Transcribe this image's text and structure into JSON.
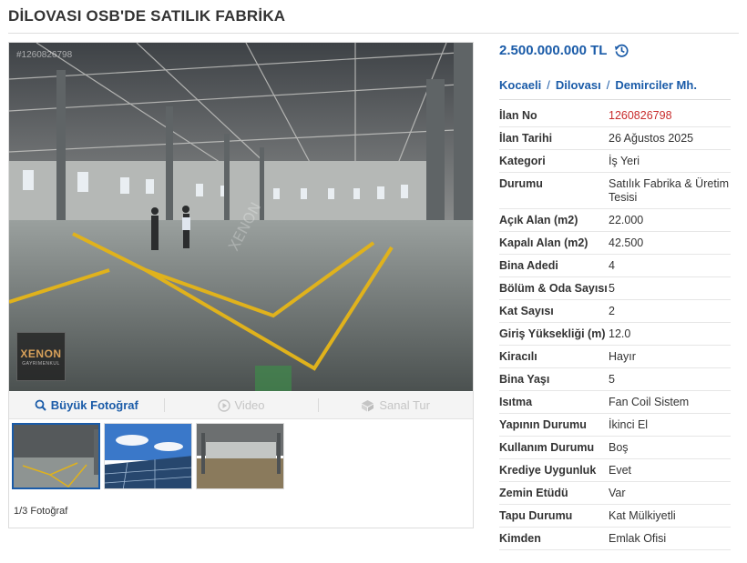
{
  "page": {
    "title": "DİLOVASI OSB'DE SATILIK FABRİKA"
  },
  "photo": {
    "listing_id_overlay": "#1260826798",
    "watermark_name": "XENON",
    "watermark_sub": "GAYRIMENKUL",
    "tabs": [
      {
        "label": "Büyük Fotoğraf",
        "icon": "magnifier-icon",
        "state": "active"
      },
      {
        "label": "Video",
        "icon": "play-icon",
        "state": "disabled"
      },
      {
        "label": "Sanal Tur",
        "icon": "cube-icon",
        "state": "disabled"
      }
    ],
    "thumbnails": [
      "warehouse-interior",
      "solar-roof",
      "warehouse-hall"
    ],
    "count_label": "1/3 Fotoğraf"
  },
  "price": {
    "value": "2.500.000.000 TL",
    "history_icon": "price-history-icon"
  },
  "location": {
    "city": "Kocaeli",
    "district": "Dilovası",
    "neighborhood": "Demirciler Mh.",
    "separator": "/"
  },
  "details": [
    {
      "label": "İlan No",
      "value": "1260826798",
      "highlight": true
    },
    {
      "label": "İlan Tarihi",
      "value": "26 Ağustos 2025"
    },
    {
      "label": "Kategori",
      "value": "İş Yeri"
    },
    {
      "label": "Durumu",
      "value": "Satılık Fabrika & Üretim Tesisi"
    },
    {
      "label": "Açık Alan (m2)",
      "value": "22.000"
    },
    {
      "label": "Kapalı Alan (m2)",
      "value": "42.500"
    },
    {
      "label": "Bina Adedi",
      "value": "4"
    },
    {
      "label": "Bölüm & Oda Sayısı",
      "value": "5"
    },
    {
      "label": "Kat Sayısı",
      "value": "2"
    },
    {
      "label": "Giriş Yüksekliği (m)",
      "value": "12.0"
    },
    {
      "label": "Kiracılı",
      "value": "Hayır"
    },
    {
      "label": "Bina Yaşı",
      "value": "5"
    },
    {
      "label": "Isıtma",
      "value": "Fan Coil Sistem"
    },
    {
      "label": "Yapının Durumu",
      "value": "İkinci El"
    },
    {
      "label": "Kullanım Durumu",
      "value": "Boş"
    },
    {
      "label": "Krediye Uygunluk",
      "value": "Evet"
    },
    {
      "label": "Zemin Etüdü",
      "value": "Var"
    },
    {
      "label": "Tapu Durumu",
      "value": "Kat Mülkiyetli"
    },
    {
      "label": "Kimden",
      "value": "Emlak Ofisi"
    }
  ],
  "colors": {
    "link_blue": "#1a5ba8",
    "highlight_red": "#c82b2b",
    "floor_line_yellow": "#e0b21c"
  }
}
